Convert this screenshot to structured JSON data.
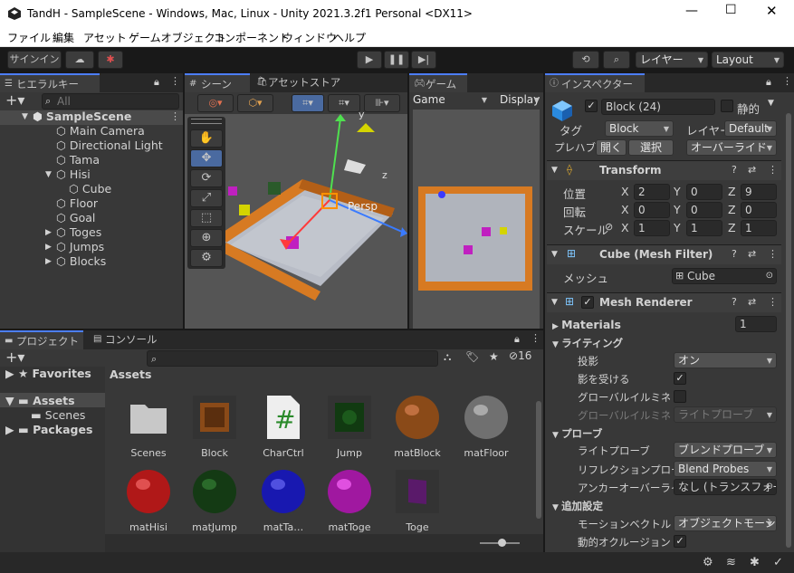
{
  "window": {
    "title": "TandH - SampleScene - Windows, Mac, Linux - Unity 2021.3.2f1 Personal <DX11>"
  },
  "menu": [
    "ファイル",
    "編集",
    "アセット",
    "ゲームオブジェクト",
    "コンポーネント",
    "ウィンドウ",
    "ヘルプ"
  ],
  "toolbar": {
    "signin": "サインイン",
    "layers": "レイヤー",
    "layout": "Layout"
  },
  "hierarchy": {
    "tab": "ヒエラルキー",
    "search_placeholder": "All",
    "items": [
      {
        "label": "SampleScene",
        "depth": 0
      },
      {
        "label": "Main Camera",
        "depth": 1
      },
      {
        "label": "Directional Light",
        "depth": 1
      },
      {
        "label": "Tama",
        "depth": 1
      },
      {
        "label": "Hisi",
        "depth": 1
      },
      {
        "label": "Cube",
        "depth": 2
      },
      {
        "label": "Floor",
        "depth": 1
      },
      {
        "label": "Goal",
        "depth": 1
      },
      {
        "label": "Toges",
        "depth": 1
      },
      {
        "label": "Jumps",
        "depth": 1
      },
      {
        "label": "Blocks",
        "depth": 1
      }
    ]
  },
  "scene": {
    "tab": "シーン",
    "tab2": "アセットストア",
    "persp": "Persp",
    "gizmo_y": "y",
    "gizmo_z": "z"
  },
  "game": {
    "tab": "ゲーム",
    "display_label": "Game",
    "display2": "Display"
  },
  "project": {
    "tab": "プロジェクト",
    "console_tab": "コンソール",
    "hidden_count": "16",
    "favorites": "Favorites",
    "assets": "Assets",
    "scenes": "Scenes",
    "packages": "Packages",
    "breadcrumb": "Assets",
    "items": [
      {
        "label": "Scenes",
        "kind": "folder"
      },
      {
        "label": "Block",
        "kind": "prefab-brown"
      },
      {
        "label": "CharCtrl",
        "kind": "script"
      },
      {
        "label": "Jump",
        "kind": "prefab-green"
      },
      {
        "label": "matBlock",
        "kind": "sphere-brown"
      },
      {
        "label": "matFloor",
        "kind": "sphere-gray"
      },
      {
        "label": "matHisi",
        "kind": "sphere-red"
      },
      {
        "label": "matJump",
        "kind": "sphere-darkgreen"
      },
      {
        "label": "matTa…",
        "kind": "sphere-blue"
      },
      {
        "label": "matToge",
        "kind": "sphere-magenta"
      },
      {
        "label": "Toge",
        "kind": "prefab-purple"
      }
    ]
  },
  "inspector": {
    "tab": "インスペクター",
    "name": "Block (24)",
    "static": "静的",
    "tag_label": "タグ",
    "tag": "Block",
    "layer_label": "レイヤー",
    "layer": "Default",
    "prefab_label": "プレハブ",
    "open": "開く",
    "select": "選択",
    "overrides": "オーバーライド",
    "transform": {
      "title": "Transform",
      "pos": "位置",
      "rot": "回転",
      "scale": "スケール",
      "px": "2",
      "py": "0",
      "pz": "9",
      "rx": "0",
      "ry": "0",
      "rz": "0",
      "sx": "1",
      "sy": "1",
      "sz": "1"
    },
    "meshfilter": {
      "title": "Cube (Mesh Filter)",
      "mesh_label": "メッシュ",
      "mesh": "Cube"
    },
    "renderer": {
      "title": "Mesh Renderer",
      "materials": "Materials",
      "mat_count": "1",
      "lighting": "ライティング",
      "cast": "投影",
      "cast_val": "オン",
      "receive": "影を受ける",
      "gi": "グローバルイルミネーション",
      "gi2": "グローバルイルミネーション",
      "gi2_val": "ライトプローブ",
      "probes": "プローブ",
      "lightprobes": "ライトプローブ",
      "lightprobes_val": "ブレンドプローブ",
      "refl": "リフレクションプローブ",
      "refl_val": "Blend Probes",
      "anchor": "アンカーオーバーライド",
      "anchor_val": "なし (トランスフォーム)",
      "extra": "追加設定",
      "motion": "モーションベクトル",
      "motion_val": "オブジェクトモーション",
      "occl": "動的オクルージョン"
    }
  }
}
